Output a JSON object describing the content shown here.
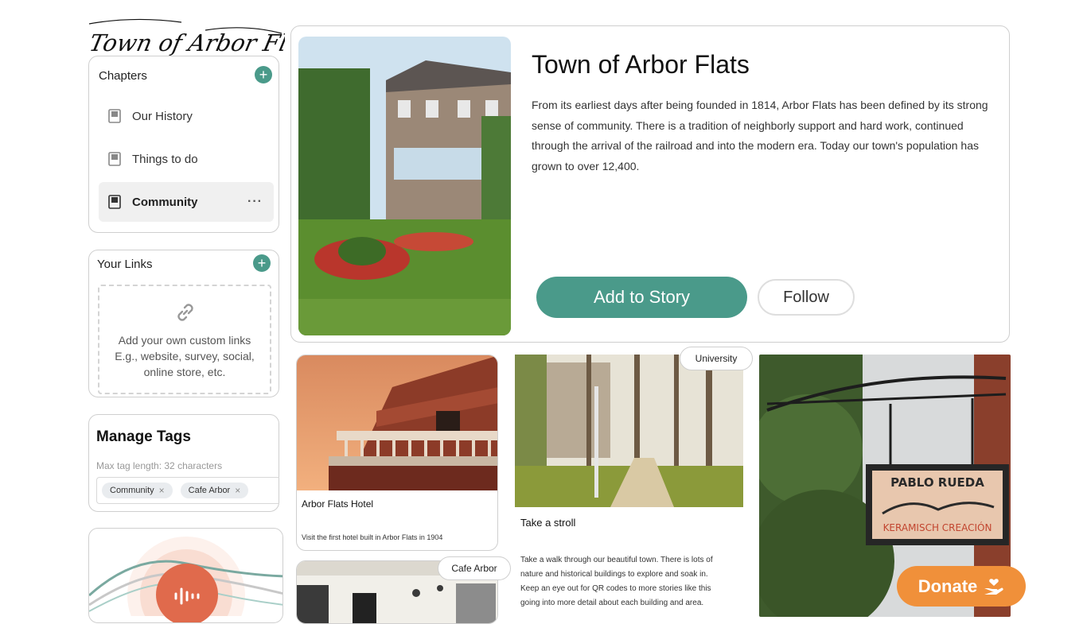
{
  "brand": {
    "logo_text": "Town of Arbor Flats"
  },
  "chapters": {
    "title": "Chapters",
    "add_label": "+",
    "items": [
      {
        "label": "Our History"
      },
      {
        "label": "Things to do"
      },
      {
        "label": "Community",
        "menu": "···"
      }
    ]
  },
  "links": {
    "title": "Your Links",
    "add_label": "+",
    "empty_line1": "Add your own custom links",
    "empty_line2": "E.g., website, survey, social,",
    "empty_line3": "online store, etc."
  },
  "tags": {
    "title": "Manage Tags",
    "hint": "Max tag length: 32 characters",
    "items": [
      {
        "label": "Community",
        "remove": "×"
      },
      {
        "label": "Cafe Arbor",
        "remove": "×"
      }
    ]
  },
  "hero": {
    "title": "Town of Arbor Flats",
    "description": "From its earliest days after being founded in 1814, Arbor Flats has been defined by its strong sense of community. There is a tradition of neighborly support and hard work, continued through the arrival of the railroad and into the modern era. Today our town's population has grown to over 12,400.",
    "add_button": "Add to Story",
    "follow_button": "Follow"
  },
  "stories": [
    {
      "title": "Arbor Flats Hotel",
      "text": "Visit the first hotel built in Arbor Flats in 1904"
    },
    {
      "tag": "University",
      "title": "Take a stroll",
      "text_lines": [
        "Take a walk through our beautiful town. There is lots of",
        "nature and historical buildings to explore and soak in.",
        "Keep an eye out for QR codes to more stories like this",
        "going into more detail about each building and area."
      ]
    },
    {
      "tag": "Cafe Arbor"
    },
    {
      "sign_line1": "PABLO RUEDA",
      "sign_line2": "KERAMISCH CREACIÓN"
    }
  ],
  "donate": {
    "label": "Donate"
  },
  "colors": {
    "accent": "#4a9a8a",
    "donate": "#f0903a",
    "audio": "#e06a4c"
  }
}
